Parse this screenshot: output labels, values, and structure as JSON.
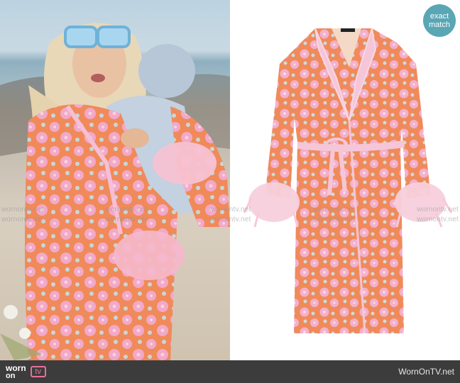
{
  "badge": {
    "line1": "exact",
    "line2": "match"
  },
  "watermarks": [
    "wornontv.net",
    "wornontv.net",
    "wornontv.net",
    "wornontv.net",
    "wornontv.net"
  ],
  "footer": {
    "logo_word1": "worn",
    "logo_word2": "on",
    "logo_word3": "tv",
    "site_name": "WornOnTV.net"
  },
  "colors": {
    "coat_base": "#f08a5a",
    "coat_flower": "#f2a9c8",
    "feather": "#f7c2d2",
    "badge": "#5aa6b5",
    "footer": "#3c3c3c",
    "logo_pink": "#e9709b"
  }
}
